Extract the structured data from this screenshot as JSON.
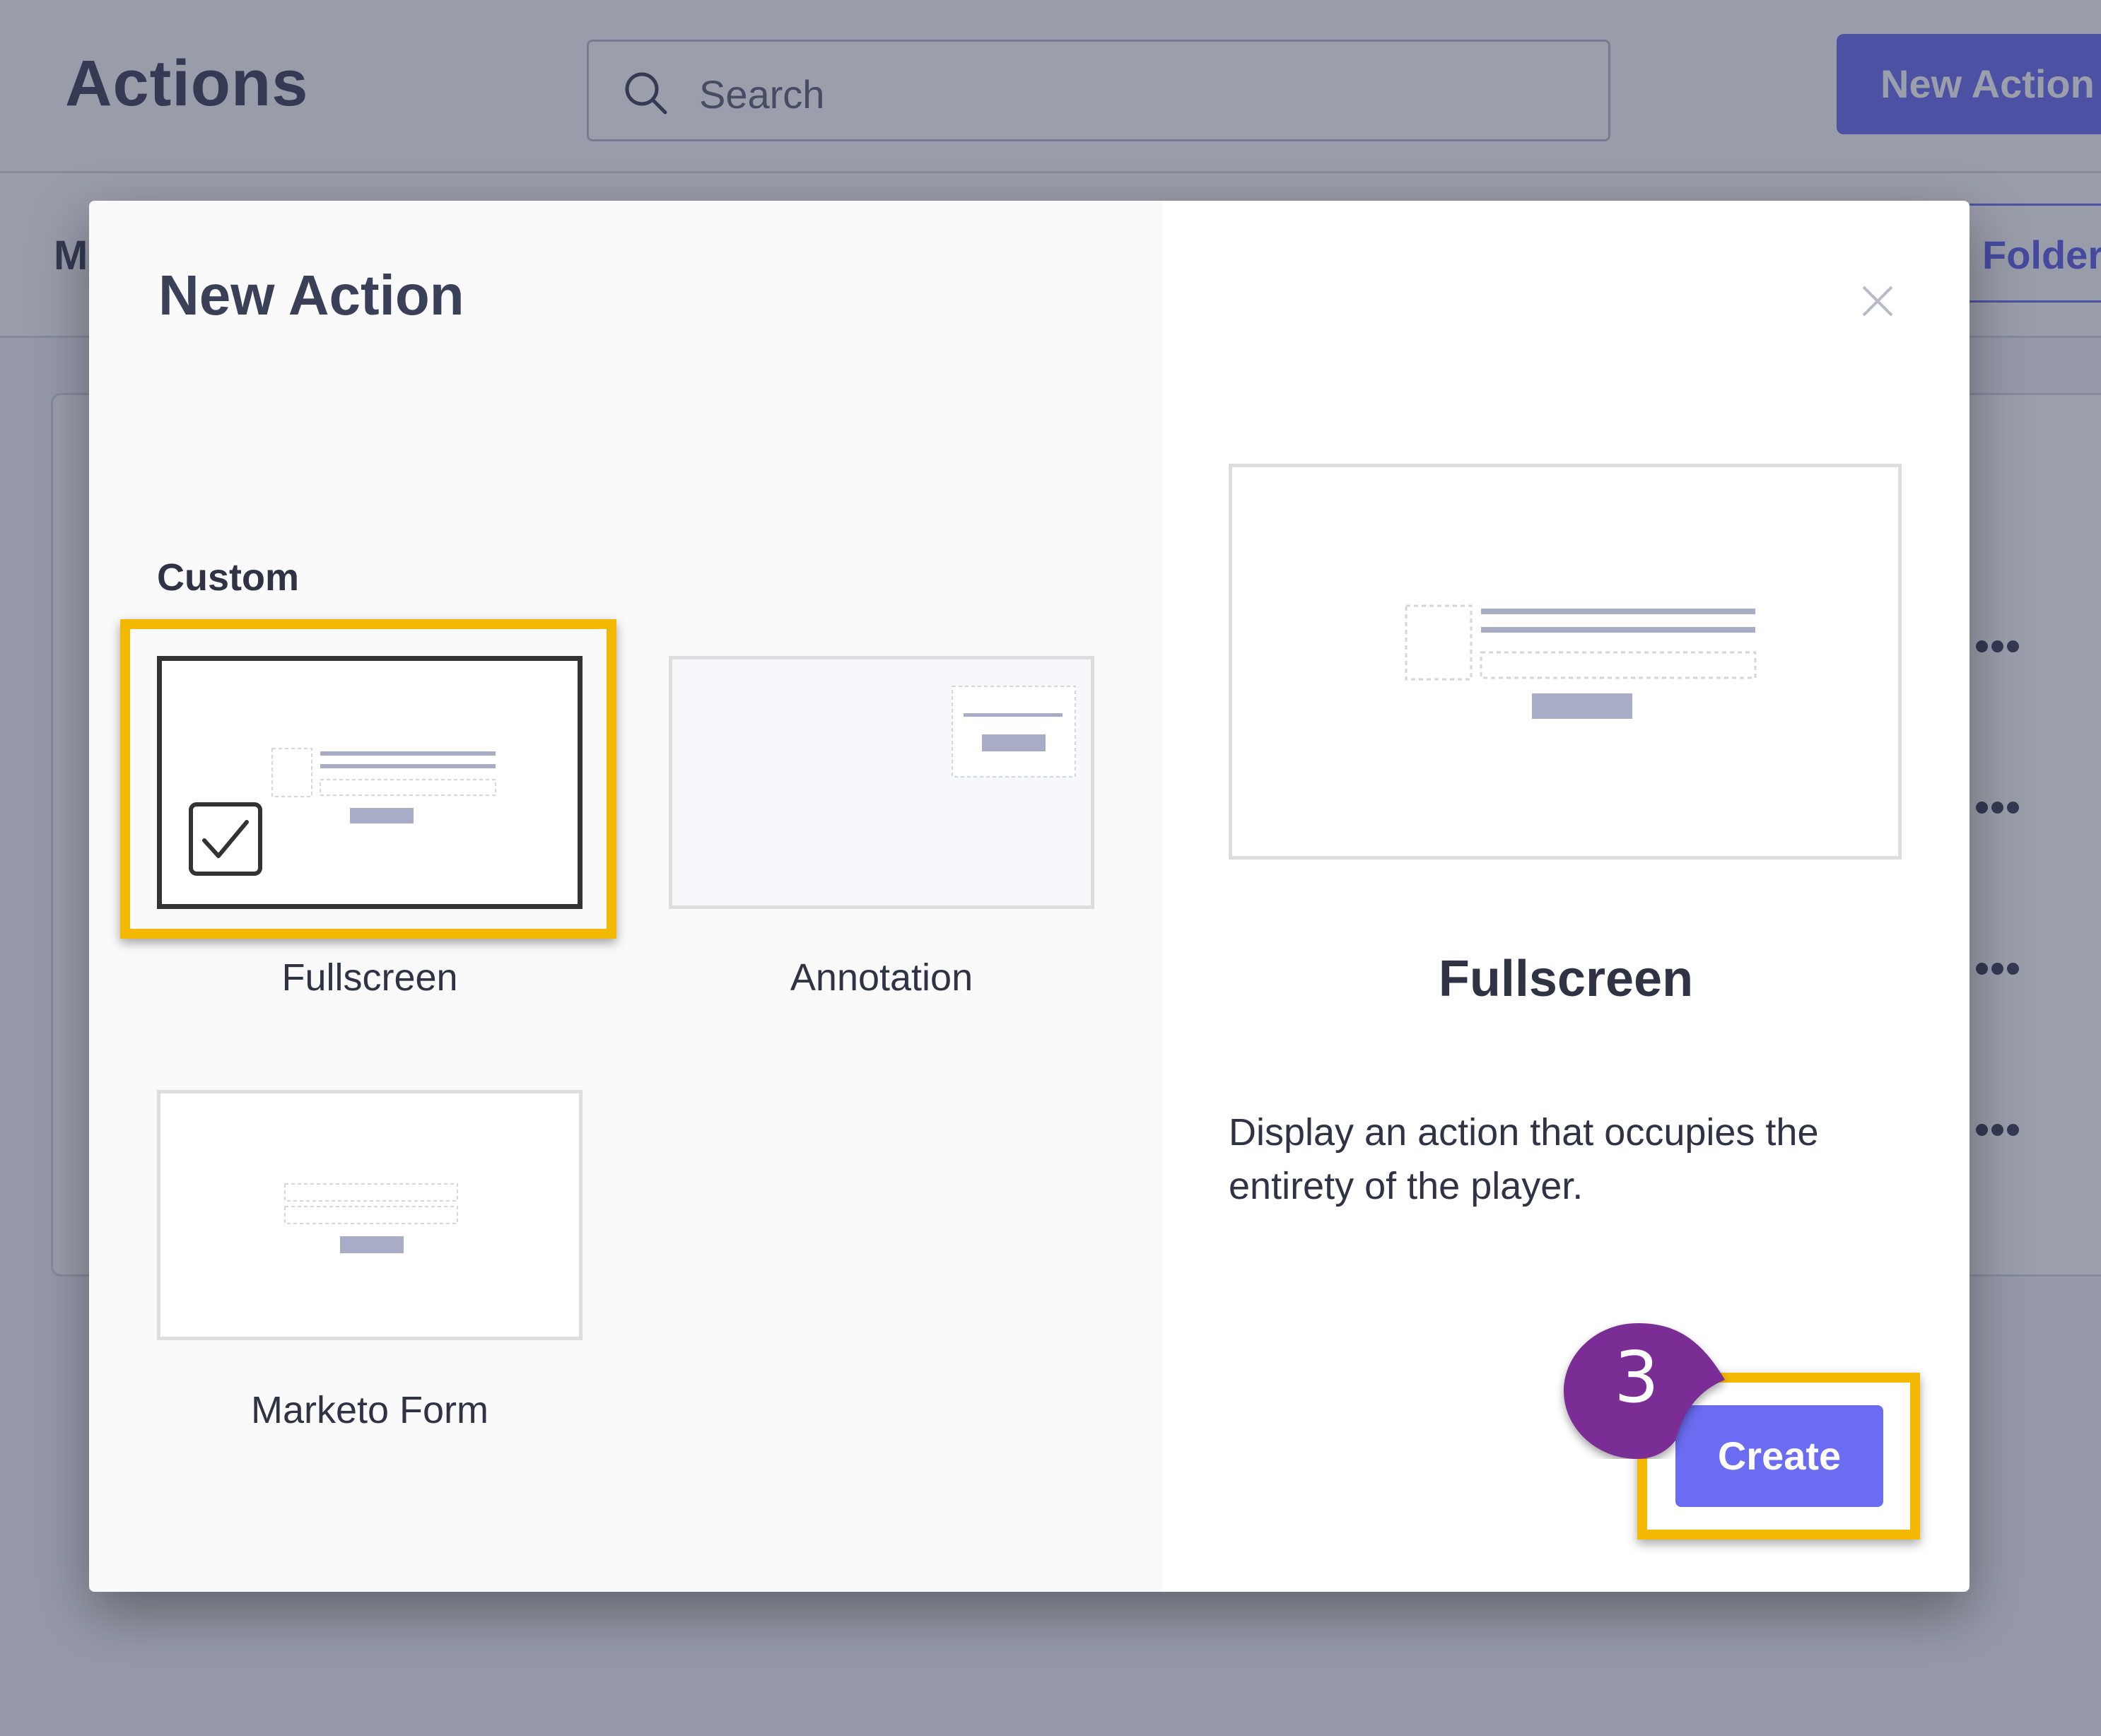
{
  "background": {
    "title": "Actions",
    "search_placeholder": "Search",
    "new_action_label": "New Action",
    "sub_tab_left": "M",
    "folder_tab": "Folder",
    "more_icon": "more-horizontal-icon"
  },
  "modal": {
    "title": "New Action",
    "close_icon": "close-icon",
    "section_label": "Custom",
    "options": [
      {
        "label": "Fullscreen",
        "selected": true
      },
      {
        "label": "Annotation",
        "selected": false
      },
      {
        "label": "Marketo Form",
        "selected": false
      }
    ],
    "preview": {
      "title": "Fullscreen",
      "description": "Display an action that occupies the entirety of the player."
    },
    "create_label": "Create",
    "step_badge": "3"
  },
  "colors": {
    "accent": "#6a6cf1",
    "highlight": "#f5b800",
    "step_badge": "#7a2f95",
    "text": "#2f3344"
  }
}
